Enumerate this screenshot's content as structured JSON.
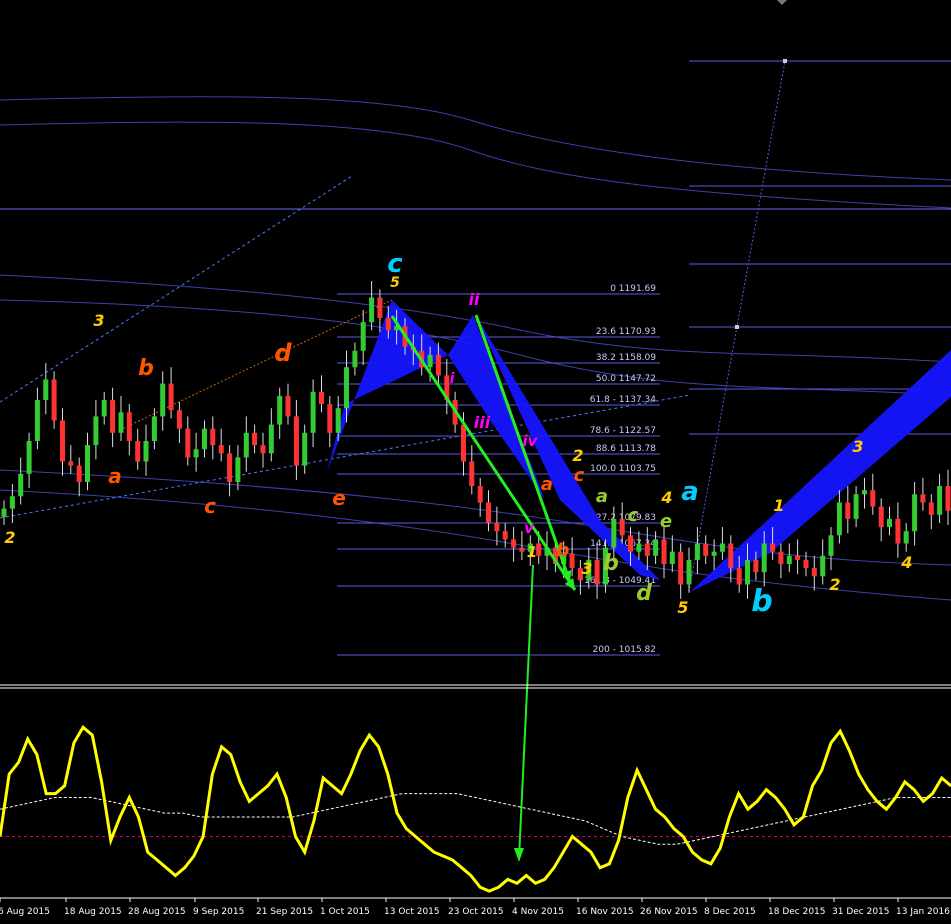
{
  "chart_data": [
    {
      "type": "candlestick",
      "description_role": "price-panel",
      "colors": {
        "bull": "#33cc33",
        "bear": "#ff3333",
        "background": "#000000"
      },
      "x": [
        "6 Aug 2015",
        "18 Aug 2015",
        "28 Aug 2015",
        "9 Sep 2015",
        "21 Sep 2015",
        "1 Oct 2015",
        "13 Oct 2015",
        "23 Oct 2015",
        "4 Nov 2015",
        "16 Nov 2015",
        "26 Nov 2015",
        "8 Dec 2015",
        "18 Dec 2015",
        "31 Dec 2015",
        "13 Jan 2016"
      ],
      "close": [
        1087,
        1093,
        1104,
        1120,
        1140,
        1150,
        1130,
        1110,
        1108,
        1100,
        1118,
        1132,
        1140,
        1124,
        1134,
        1120,
        1110,
        1120,
        1132,
        1148,
        1135,
        1126,
        1112,
        1116,
        1126,
        1118,
        1114,
        1100,
        1112,
        1124,
        1118,
        1114,
        1128,
        1142,
        1132,
        1108,
        1124,
        1144,
        1138,
        1124,
        1136,
        1156,
        1164,
        1178,
        1190,
        1180,
        1174,
        1176,
        1166,
        1164,
        1156,
        1162,
        1152,
        1140,
        1128,
        1110,
        1098,
        1090,
        1080,
        1076,
        1072,
        1068,
        1066,
        1070,
        1064,
        1068,
        1060,
        1065,
        1058,
        1052,
        1062,
        1050,
        1068,
        1082,
        1074,
        1066,
        1070,
        1064,
        1072,
        1060,
        1066,
        1050,
        1062,
        1070,
        1064,
        1066,
        1070,
        1058,
        1050,
        1062,
        1056,
        1070,
        1066,
        1060,
        1064,
        1062,
        1058,
        1054,
        1064,
        1074,
        1090,
        1082,
        1094,
        1096,
        1088,
        1078,
        1082,
        1070,
        1076,
        1094,
        1090,
        1084,
        1098,
        1086
      ],
      "fib_levels": [
        {
          "label": "0 1191.69",
          "value": 1191.69
        },
        {
          "label": "23.6 1170.93",
          "value": 1170.93
        },
        {
          "label": "38.2 1158.09",
          "value": 1158.09
        },
        {
          "label": "50.0 1147.72",
          "value": 1147.72
        },
        {
          "label": "61.8 - 1137.34",
          "value": 1137.34
        },
        {
          "label": "78.6 - 1122.57",
          "value": 1122.57
        },
        {
          "label": "88.6 1113.78",
          "value": 1113.78
        },
        {
          "label": "100.0 1103.75",
          "value": 1103.75
        },
        {
          "label": "127.2 1079.83",
          "value": 1079.83
        },
        {
          "label": "141.4 1067.34",
          "value": 1067.34
        },
        {
          "label": "161.8 - 1049.41",
          "value": 1049.41
        },
        {
          "label": "200 - 1015.82",
          "value": 1015.82
        }
      ],
      "wave_labels": [
        {
          "text": "2",
          "color": "#ffcc00"
        },
        {
          "text": "3",
          "color": "#ffcc00"
        },
        {
          "text": "a",
          "color": "#ff5500"
        },
        {
          "text": "b",
          "color": "#ff5500"
        },
        {
          "text": "c",
          "color": "#ff5500"
        },
        {
          "text": "d",
          "color": "#ff5500"
        },
        {
          "text": "e",
          "color": "#ff5500"
        },
        {
          "text": "c",
          "color": "#00ccff"
        },
        {
          "text": "5",
          "color": "#ffcc00"
        },
        {
          "text": "ii",
          "color": "#ff00ff"
        },
        {
          "text": "i",
          "color": "#ff00ff"
        },
        {
          "text": "iii",
          "color": "#ff00ff"
        },
        {
          "text": "iv",
          "color": "#ff00ff"
        },
        {
          "text": "v",
          "color": "#ff00ff"
        },
        {
          "text": "1",
          "color": "#ffcc00"
        },
        {
          "text": "2",
          "color": "#ffcc00"
        },
        {
          "text": "a",
          "color": "#ff5500"
        },
        {
          "text": "b",
          "color": "#ff5500"
        },
        {
          "text": "c",
          "color": "#ff5500"
        },
        {
          "text": "3",
          "color": "#ffcc00"
        },
        {
          "text": "a",
          "color": "#99cc33"
        },
        {
          "text": "b",
          "color": "#99cc33"
        },
        {
          "text": "c",
          "color": "#99cc33"
        },
        {
          "text": "d",
          "color": "#99cc33"
        },
        {
          "text": "e",
          "color": "#99cc33"
        },
        {
          "text": "4",
          "color": "#ffcc00"
        },
        {
          "text": "5",
          "color": "#ffcc00"
        },
        {
          "text": "a",
          "color": "#00ccff"
        },
        {
          "text": "b",
          "color": "#00ccff"
        },
        {
          "text": "1",
          "color": "#ffcc00"
        },
        {
          "text": "2",
          "color": "#ffcc00"
        },
        {
          "text": "3",
          "color": "#ffcc00"
        },
        {
          "text": "4",
          "color": "#ffcc00"
        }
      ]
    },
    {
      "type": "line",
      "description_role": "oscillator-panel",
      "ylim": [
        0,
        100
      ],
      "series": [
        {
          "color": "#ffff00",
          "values": [
            30,
            62,
            68,
            80,
            72,
            52,
            52,
            56,
            78,
            86,
            82,
            58,
            28,
            40,
            50,
            40,
            22,
            18,
            14,
            10,
            14,
            20,
            30,
            62,
            76,
            72,
            58,
            48,
            52,
            56,
            62,
            50,
            30,
            22,
            38,
            60,
            56,
            52,
            62,
            74,
            82,
            76,
            62,
            42,
            34,
            30,
            26,
            22,
            20,
            18,
            14,
            10,
            4,
            2,
            4,
            8,
            6,
            10,
            6,
            8,
            14,
            22,
            30,
            26,
            22,
            14,
            16,
            28,
            50,
            64,
            54,
            44,
            40,
            34,
            30,
            22,
            18,
            16,
            24,
            40,
            52,
            44,
            48,
            54,
            50,
            44,
            36,
            40,
            56,
            64,
            78,
            84,
            74,
            62,
            54,
            48,
            44,
            50,
            58,
            54,
            48,
            52,
            60,
            56
          ]
        },
        {
          "color": "#ffffff",
          "values": [
            44,
            46,
            48,
            50,
            50,
            50,
            48,
            46,
            44,
            42,
            42,
            40,
            40,
            40,
            40,
            40,
            40,
            42,
            44,
            46,
            48,
            50,
            52,
            52,
            52,
            52,
            50,
            48,
            46,
            44,
            42,
            40,
            38,
            34,
            30,
            28,
            26,
            26,
            28,
            30,
            32,
            34,
            36,
            38,
            40,
            42,
            44,
            46,
            48,
            50,
            50,
            50,
            50
          ]
        },
        {
          "color": "#cc0066",
          "values": [
            30,
            30
          ]
        }
      ]
    }
  ]
}
